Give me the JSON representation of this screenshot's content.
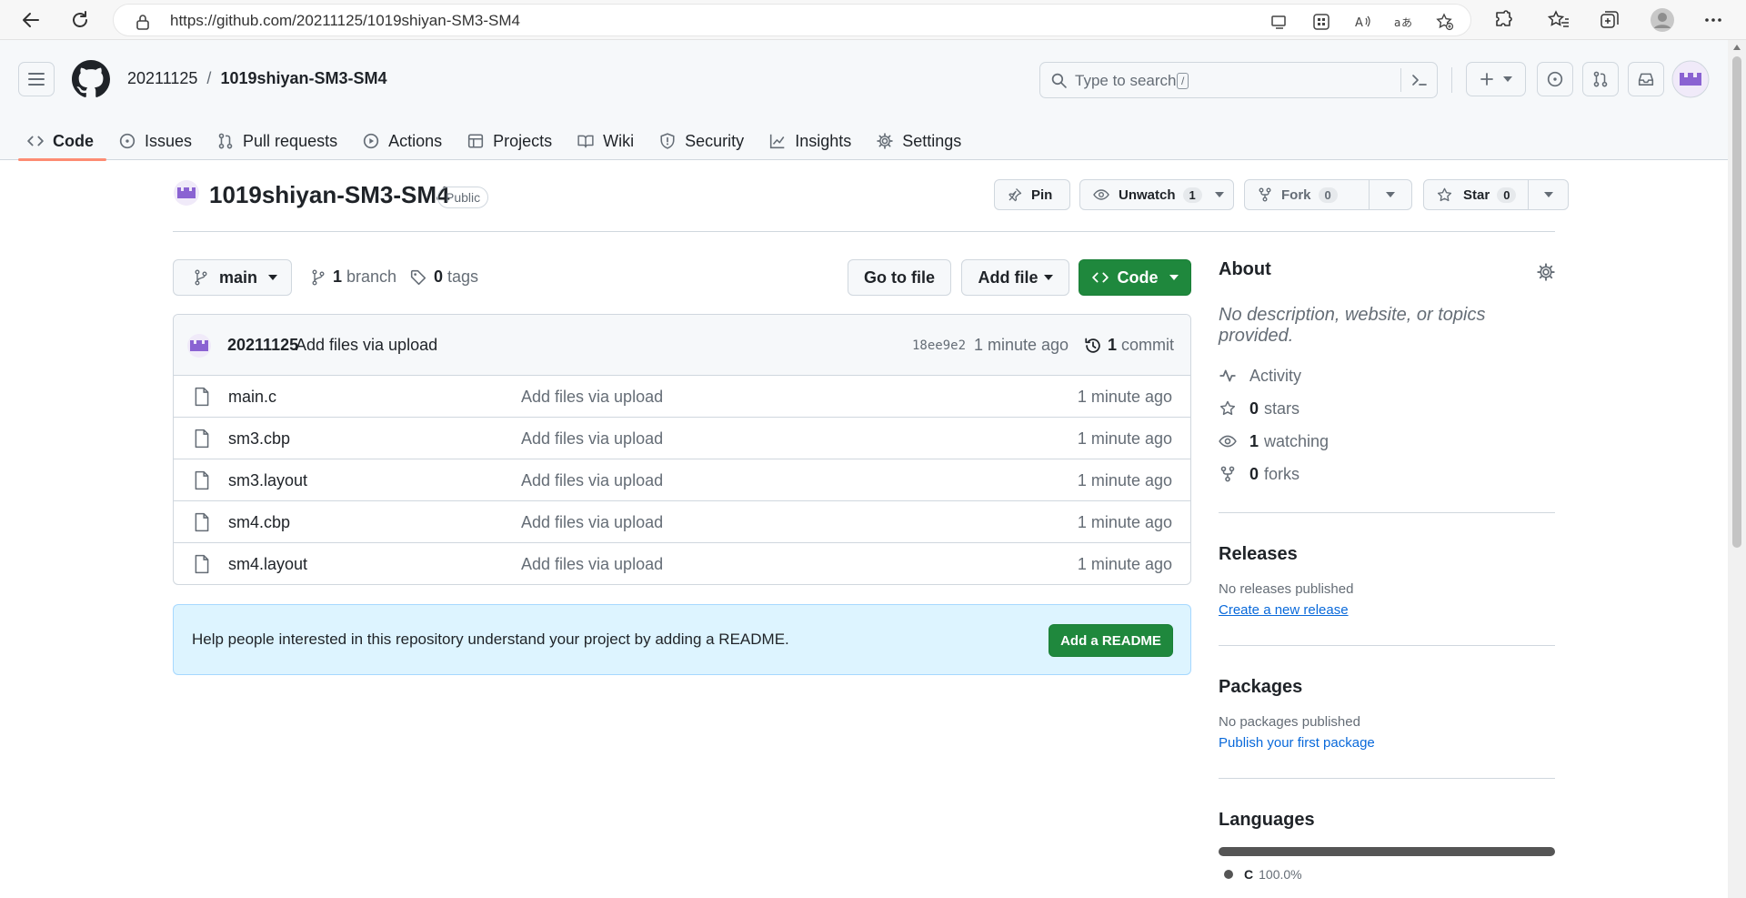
{
  "browser": {
    "url": "https://github.com/20211125/1019shiyan-SM3-SM4"
  },
  "header": {
    "owner": "20211125",
    "separator": "/",
    "repo": "1019shiyan-SM3-SM4",
    "search_placeholder": "Type to search",
    "search_key": "/"
  },
  "tabs": [
    {
      "label": "Code",
      "icon": "code-icon",
      "active": true
    },
    {
      "label": "Issues",
      "icon": "issue-icon"
    },
    {
      "label": "Pull requests",
      "icon": "pull-request-icon"
    },
    {
      "label": "Actions",
      "icon": "play-icon"
    },
    {
      "label": "Projects",
      "icon": "table-icon"
    },
    {
      "label": "Wiki",
      "icon": "book-icon"
    },
    {
      "label": "Security",
      "icon": "shield-icon"
    },
    {
      "label": "Insights",
      "icon": "graph-icon"
    },
    {
      "label": "Settings",
      "icon": "gear-icon"
    }
  ],
  "repo": {
    "name": "1019shiyan-SM3-SM4",
    "visibility": "Public",
    "pin_label": "Pin",
    "unwatch_label": "Unwatch",
    "watch_count": "1",
    "fork_label": "Fork",
    "fork_count": "0",
    "star_label": "Star",
    "star_count": "0"
  },
  "toolbar": {
    "branch": "main",
    "branch_count": "1",
    "branch_label": "branch",
    "tag_count": "0",
    "tag_label": "tags",
    "go_to_file": "Go to file",
    "add_file": "Add file",
    "code": "Code"
  },
  "commit": {
    "author": "20211125",
    "message": "Add files via upload",
    "sha": "18ee9e2",
    "time": "1 minute ago",
    "count": "1",
    "count_label": "commit"
  },
  "files": [
    {
      "name": "main.c",
      "message": "Add files via upload",
      "time": "1 minute ago"
    },
    {
      "name": "sm3.cbp",
      "message": "Add files via upload",
      "time": "1 minute ago"
    },
    {
      "name": "sm3.layout",
      "message": "Add files via upload",
      "time": "1 minute ago"
    },
    {
      "name": "sm4.cbp",
      "message": "Add files via upload",
      "time": "1 minute ago"
    },
    {
      "name": "sm4.layout",
      "message": "Add files via upload",
      "time": "1 minute ago"
    }
  ],
  "readme": {
    "text": "Help people interested in this repository understand your project by adding a README.",
    "button": "Add a README"
  },
  "about": {
    "title": "About",
    "description": "No description, website, or topics provided.",
    "activity": "Activity",
    "stars_count": "0",
    "stars_label": "stars",
    "watching_count": "1",
    "watching_label": "watching",
    "forks_count": "0",
    "forks_label": "forks"
  },
  "releases": {
    "title": "Releases",
    "none": "No releases published",
    "link": "Create a new release"
  },
  "packages": {
    "title": "Packages",
    "none": "No packages published",
    "link": "Publish your first package"
  },
  "languages": {
    "title": "Languages",
    "name": "C",
    "percent": "100.0%",
    "fraction": 1.0,
    "color": "#555555"
  },
  "colors": {
    "green": "#1f883d",
    "accent_underline": "#fd8c73",
    "link": "#0969da",
    "avatar": "#8a63d2"
  }
}
